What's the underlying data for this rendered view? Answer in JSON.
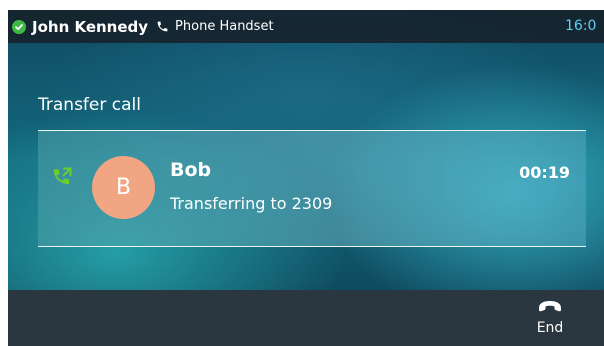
{
  "status_bar": {
    "account_name": "John Kennedy",
    "device_label": "Phone Handset",
    "clock": "16:0",
    "presence_color": "#3fb944"
  },
  "screen_title": "Transfer call",
  "call": {
    "contact_name": "Bob",
    "avatar_initial": "B",
    "detail": "Transferring to 2309",
    "timer": "00:19",
    "avatar_color": "#f2a582",
    "call_icon_color": "#6ccd2e"
  },
  "softkeys": {
    "end_label": "End"
  },
  "icons": {
    "presence": "check-circle-icon",
    "handset": "phone-handset-icon",
    "call_status": "call-transfer-icon",
    "end": "hang-up-icon"
  }
}
